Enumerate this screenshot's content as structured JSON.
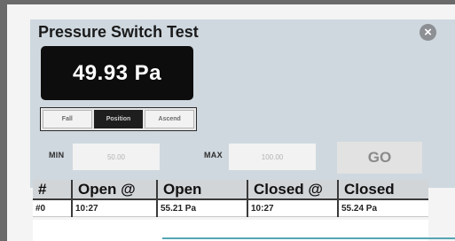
{
  "dialog": {
    "title": "Pressure Switch Test"
  },
  "reading": {
    "value": "49.93 Pa"
  },
  "modes": {
    "items": [
      "Fall",
      "Position",
      "Ascend"
    ],
    "selected": "Position"
  },
  "range": {
    "min_label": "MIN",
    "min_value": "50.00",
    "max_label": "MAX",
    "max_value": "100.00",
    "go_label": "GO"
  },
  "results": {
    "headers": [
      "#",
      "Open @",
      "Open",
      "Closed @",
      "Closed"
    ],
    "rows": [
      [
        "#0",
        "10:27",
        "55.21 Pa",
        "10:27",
        "55.24 Pa"
      ]
    ]
  },
  "colors": {
    "display_background": "#0d0d0d",
    "panel_background": "#cfd8df",
    "header_background": "#d2d5d8",
    "accent_line": "#55a5b4"
  },
  "icons": {
    "close": "close-icon"
  }
}
